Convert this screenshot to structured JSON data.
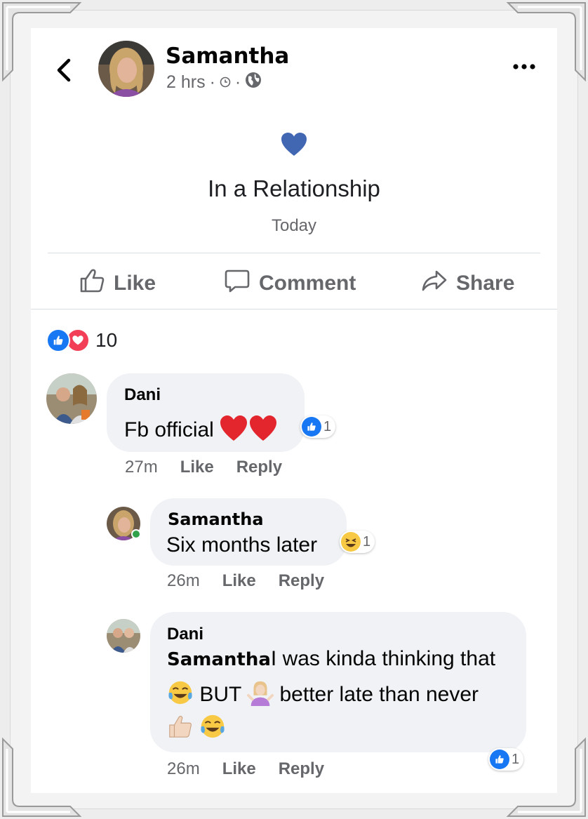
{
  "header": {
    "name": "Samantha",
    "time": "2 hrs",
    "separator": "·"
  },
  "life_event": {
    "title": "In a Relationship",
    "date": "Today",
    "heart_color": "#4267b2"
  },
  "actions": {
    "like": "Like",
    "comment": "Comment",
    "share": "Share"
  },
  "reactions": {
    "count": "10"
  },
  "comments": [
    {
      "author": "Dani",
      "text": "Fb official",
      "reaction_count": "1",
      "time": "27m",
      "like": "Like",
      "reply": "Reply"
    },
    {
      "author": "Samantha",
      "text": "Six months later",
      "reaction_count": "1",
      "time": "26m",
      "like": "Like",
      "reply": "Reply"
    },
    {
      "author": "Dani",
      "mention": "Samantha",
      "text_line1": "I was kinda thinking that",
      "text_line2a": "BUT",
      "text_line2b": "better late than never",
      "reaction_count": "1",
      "time": "26m",
      "like": "Like",
      "reply": "Reply"
    }
  ],
  "colors": {
    "like_blue": "#1877f2",
    "love_red": "#f33e58",
    "meta_gray": "#65676b",
    "bubble_gray": "#f0f2f5"
  }
}
